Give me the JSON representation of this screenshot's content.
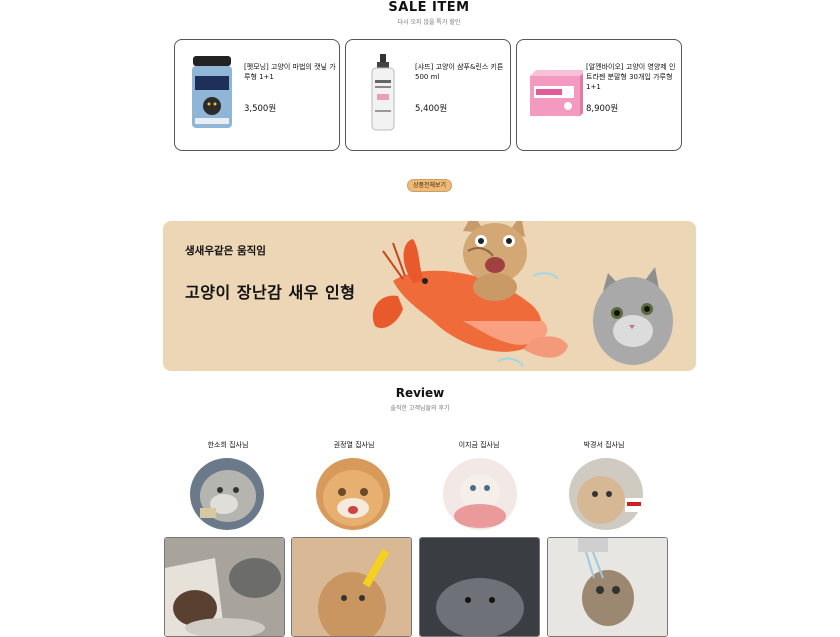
{
  "sale": {
    "title": "SALE ITEM",
    "subtitle": "다시 오지 않을 특가 할인"
  },
  "products": [
    {
      "name": "[펫모닝] 고양이 마법의 캣닢 가루형 1+1",
      "price": "3,500원",
      "icon": "catnip-jar-icon"
    },
    {
      "name": "[샤뜨] 고양이 샴푸&린스 키튼 500 ml",
      "price": "5,400원",
      "icon": "shampoo-bottle-icon"
    },
    {
      "name": "[알껜바이오] 고양이 영양제 인트라젠 분말형 30개입 가루형 1+1",
      "price": "8,900원",
      "icon": "supplement-box-icon"
    }
  ],
  "viewall_label": "상품전체보기",
  "banner": {
    "subtitle": "생새우같은 움직임",
    "title": "고양이 장난감 새우 인형"
  },
  "review": {
    "title": "Review",
    "subtitle": "솔직한 고객님들의 후기",
    "reviewers": [
      {
        "name": "한소희 집사님"
      },
      {
        "name": "권정열 집사님"
      },
      {
        "name": "이지금 집사님"
      },
      {
        "name": "박경서 집사님"
      }
    ]
  },
  "colors": {
    "banner_bg": "#ecd6b5",
    "button_bg": "#f0b976"
  }
}
